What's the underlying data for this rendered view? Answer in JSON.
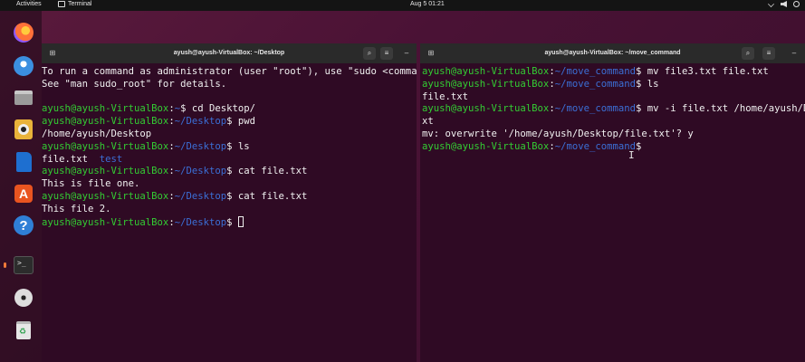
{
  "topbar": {
    "activities": "Activities",
    "app_name": "Terminal",
    "clock": "Aug 5  01:21",
    "tray": [
      "network-icon",
      "volume-icon",
      "power-icon"
    ]
  },
  "dock": {
    "items": [
      {
        "name": "firefox",
        "icon": "firefox-icon"
      },
      {
        "name": "thunderbird",
        "icon": "thunderbird-icon"
      },
      {
        "name": "files",
        "icon": "files-icon"
      },
      {
        "name": "rhythmbox",
        "icon": "rhythmbox-icon"
      },
      {
        "name": "writer",
        "icon": "writer-icon"
      },
      {
        "name": "app-center",
        "icon": "app-center-icon",
        "glyph": "A"
      },
      {
        "name": "help",
        "icon": "help-icon",
        "glyph": "?"
      },
      {
        "name": "terminal",
        "icon": "terminal-icon",
        "glyph": ">_",
        "active": true
      },
      {
        "name": "disc",
        "icon": "disc-icon"
      },
      {
        "name": "trash",
        "icon": "trash-icon"
      }
    ]
  },
  "left_terminal": {
    "title": "ayush@ayush-VirtualBox: ~/Desktop",
    "buttons": {
      "search": "search-icon",
      "menu": "hamburger-icon",
      "minimize": "–"
    },
    "lines": [
      {
        "type": "text",
        "text": "To run a command as administrator (user \"root\"), use \"sudo <command>\"."
      },
      {
        "type": "text",
        "text": "See \"man sudo_root\" for details."
      },
      {
        "type": "text",
        "text": ""
      },
      {
        "type": "prompt",
        "user": "ayush@ayush-VirtualBox",
        "path": "~",
        "cmd": " cd Desktop/"
      },
      {
        "type": "prompt",
        "user": "ayush@ayush-VirtualBox",
        "path": "~/Desktop",
        "cmd": " pwd"
      },
      {
        "type": "text",
        "text": "/home/ayush/Desktop"
      },
      {
        "type": "prompt",
        "user": "ayush@ayush-VirtualBox",
        "path": "~/Desktop",
        "cmd": " ls"
      },
      {
        "type": "ls",
        "file": "file.txt",
        "dir": "test"
      },
      {
        "type": "prompt",
        "user": "ayush@ayush-VirtualBox",
        "path": "~/Desktop",
        "cmd": " cat file.txt"
      },
      {
        "type": "text",
        "text": "This is file one."
      },
      {
        "type": "prompt",
        "user": "ayush@ayush-VirtualBox",
        "path": "~/Desktop",
        "cmd": " cat file.txt"
      },
      {
        "type": "text",
        "text": "This file 2."
      },
      {
        "type": "prompt_cursor",
        "user": "ayush@ayush-VirtualBox",
        "path": "~/Desktop",
        "cmd": " "
      }
    ]
  },
  "right_terminal": {
    "title": "ayush@ayush-VirtualBox: ~/move_command",
    "buttons": {
      "search": "search-icon",
      "menu": "hamburger-icon",
      "minimize": "–"
    },
    "lines": [
      {
        "type": "prompt",
        "user": "ayush@ayush-VirtualBox",
        "path": "~/move_command",
        "cmd": " mv file3.txt file.txt"
      },
      {
        "type": "prompt",
        "user": "ayush@ayush-VirtualBox",
        "path": "~/move_command",
        "cmd": " ls"
      },
      {
        "type": "text",
        "text": "file.txt"
      },
      {
        "type": "prompt",
        "user": "ayush@ayush-VirtualBox",
        "path": "~/move_command",
        "cmd": " mv -i file.txt /home/ayush/Desktop/fi"
      },
      {
        "type": "text",
        "text": "xt"
      },
      {
        "type": "text",
        "text": "mv: overwrite '/home/ayush/Desktop/file.txt'? y"
      },
      {
        "type": "prompt",
        "user": "ayush@ayush-VirtualBox",
        "path": "~/move_command",
        "cmd": " "
      }
    ]
  },
  "colors": {
    "user": "#33cc33",
    "path": "#3b6fd6",
    "terminal_bg": "#2f0a24",
    "accent": "#e95420"
  }
}
